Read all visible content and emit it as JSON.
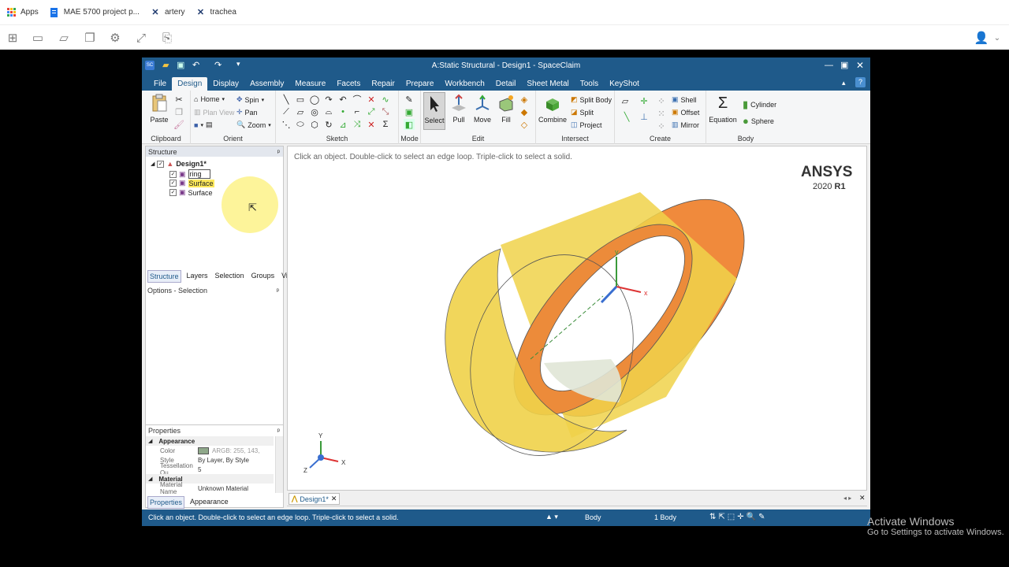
{
  "bookmarks": {
    "items": [
      {
        "label": "Apps",
        "icon": "apps-grid-icon"
      },
      {
        "label": "MAE 5700 project p...",
        "icon": "doc-icon"
      },
      {
        "label": "artery",
        "icon": "x-logo-icon"
      },
      {
        "label": "trachea",
        "icon": "x-logo-icon"
      }
    ]
  },
  "window": {
    "title": "A:Static Structural - Design1 - SpaceClaim"
  },
  "menu": {
    "items": [
      "File",
      "Design",
      "Display",
      "Assembly",
      "Measure",
      "Facets",
      "Repair",
      "Prepare",
      "Workbench",
      "Detail",
      "Sheet Metal",
      "Tools",
      "KeyShot"
    ],
    "active": "Design"
  },
  "ribbon": {
    "clipboard": {
      "paste": "Paste",
      "label": "Clipboard"
    },
    "orient": {
      "home": "Home",
      "plan_view": "Plan View",
      "spin": "Spin",
      "pan": "Pan",
      "zoom": "Zoom",
      "label": "Orient"
    },
    "sketch": {
      "label": "Sketch"
    },
    "mode": {
      "label": "Mode"
    },
    "edit": {
      "select": "Select",
      "pull": "Pull",
      "move": "Move",
      "fill": "Fill",
      "label": "Edit"
    },
    "intersect": {
      "combine": "Combine",
      "split_body": "Split Body",
      "split": "Split",
      "project": "Project",
      "label": "Intersect"
    },
    "create": {
      "shell": "Shell",
      "offset": "Offset",
      "mirror": "Mirror",
      "label": "Create"
    },
    "body": {
      "equation": "Equation",
      "cylinder": "Cylinder",
      "sphere": "Sphere",
      "label": "Body"
    }
  },
  "structure": {
    "title": "Structure",
    "pin": "ᵖ",
    "tree": [
      {
        "label": "Design1*",
        "bold": true
      },
      {
        "label": "ring",
        "editing": true
      },
      {
        "label": "Surface",
        "highlight": true
      },
      {
        "label": "Surface",
        "highlight": false
      }
    ],
    "tabs": [
      "Structure",
      "Layers",
      "Selection",
      "Groups",
      "Views"
    ],
    "active_tab": "Structure",
    "options_title": "Options - Selection"
  },
  "properties": {
    "title": "Properties",
    "sections": {
      "appearance": "Appearance",
      "material": "Material"
    },
    "rows": [
      {
        "key": "Color",
        "value": "ARGB: 255, 143,"
      },
      {
        "key": "Style",
        "value": "By Layer, By Style"
      },
      {
        "key": "Tessellation Qu",
        "value": "5"
      },
      {
        "key": "Material Name",
        "value": "Unknown Material"
      }
    ],
    "tabs": [
      "Properties",
      "Appearance"
    ],
    "color_swatch": "#8fa88a"
  },
  "viewport": {
    "hint": "Click an object. Double-click to select an edge loop. Triple-click to select a solid.",
    "brand": "ANSYS",
    "version_prefix": "2020",
    "version_release": "R1",
    "doc_tab": "Design1*",
    "axes": {
      "x": "x",
      "y": "y",
      "z": "z"
    },
    "triad": {
      "x": "X",
      "y": "Y",
      "z": "Z"
    }
  },
  "statusbar": {
    "message": "Click an object. Double-click to select an edge loop. Triple-click to select a solid.",
    "filter": "Body",
    "count": "1 Body"
  },
  "watermark": {
    "line1": "Activate Windows",
    "line2": "Go to Settings to activate Windows."
  },
  "colors": {
    "ribbon_blue": "#1f5a8a",
    "cylinder_yellow": "#f0d24a",
    "cylinder_orange": "#f08a3c"
  }
}
